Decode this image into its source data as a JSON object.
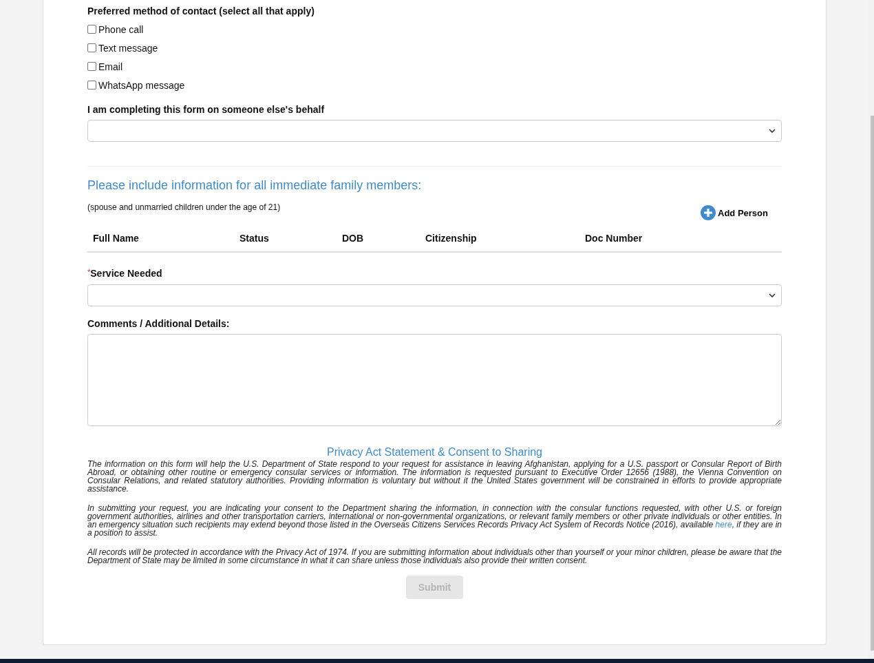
{
  "contact": {
    "label": "Preferred method of contact (select all that apply)",
    "options": [
      {
        "label": "Phone call",
        "checked": false
      },
      {
        "label": "Text message",
        "checked": false
      },
      {
        "label": "Email",
        "checked": false
      },
      {
        "label": "WhatsApp message",
        "checked": false
      }
    ]
  },
  "behalf": {
    "label": "I am completing this form on someone else's behalf"
  },
  "family": {
    "title": "Please include information for all immediate family members:",
    "note": "(spouse and unmarried children under the age of 21)",
    "add_button": "Add Person",
    "columns": [
      "Full Name",
      "Status",
      "DOB",
      "Citizenship",
      "Doc Number"
    ]
  },
  "service": {
    "required_mark": "*",
    "label": "Service Needed"
  },
  "comments": {
    "label": "Comments / Additional Details:"
  },
  "privacy": {
    "title": "Privacy Act Statement & Consent to Sharing",
    "paragraphs": [
      {
        "text": "The information on this form will help the U.S. Department of State respond to your request for assistance in leaving Afghanistan, applying for a U.S. passport or Consular Report of Birth Abroad, or obtaining other routine or emergency consular services or information. The information is requested pursuant to Executive Order 12656 (1988), the Vienna Convention on Consular Relations, and related statutory authorities. Providing information is voluntary but without it the United States government will be constrained in efforts to provide appropriate assistance."
      },
      {
        "text": "In submitting your request, you are indicating your consent to the Department sharing the information, in connection with the consular functions requested, with other U.S. or foreign government authorities, airlines and other transportation carriers, international or non-governmental organizations, or relevant family members or other private individuals or other entities. In an emergency situation such recipients may extend beyond those listed in the Overseas Citizens Services Records Privacy Act System of Records Notice (2016), available ",
        "link": "here",
        "after": ", if they are in a position to assist."
      },
      {
        "text": "All records will be protected in accordance with the Privacy Act of 1974. If you are submitting information about individuals other than yourself or your minor children, please be aware that the Department of State may be limited in some circumstance in what it can share unless those individuals also provide their written consent."
      }
    ]
  },
  "submit": {
    "label": "Submit",
    "disabled": true
  }
}
